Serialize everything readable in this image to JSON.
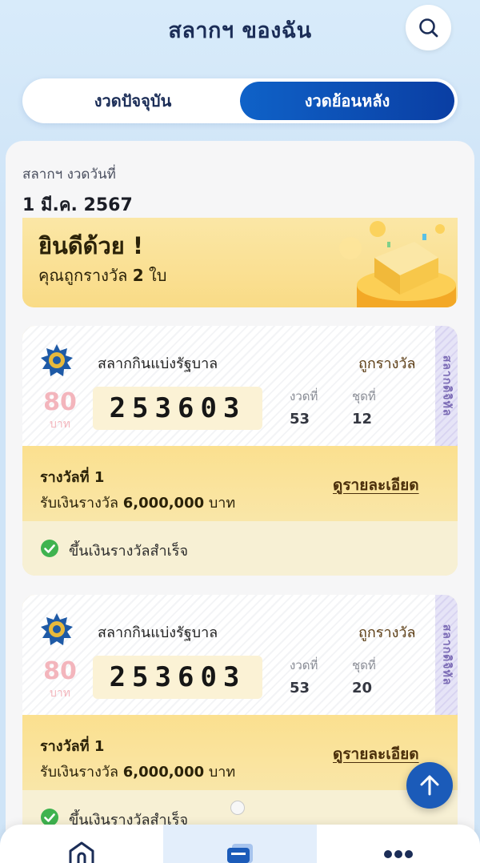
{
  "header": {
    "title": "สลากฯ ของฉัน",
    "search_icon": "search-icon"
  },
  "tabs": {
    "current_label": "งวดปัจจุบัน",
    "past_label": "งวดย้อนหลัง",
    "selected": "past"
  },
  "draw": {
    "caption": "สลากฯ งวดวันที่",
    "date": "1 มี.ค. 2567"
  },
  "banner": {
    "title": "ยินดีด้วย !",
    "sub_prefix": "คุณถูกรางวัล",
    "count": "2",
    "sub_suffix": "ใบ"
  },
  "tickets": [
    {
      "lottery_name": "สลากกินแบ่งรัฐบาล",
      "status": "ถูกรางวัล",
      "price": "80",
      "price_unit": "บาท",
      "number": "253603",
      "draw_label": "งวดที่",
      "draw_no": "53",
      "set_label": "ชุดที่",
      "set_no": "12",
      "side_tag": "สลากดิจิทัล",
      "prize_name": "รางวัลที่ 1",
      "prize_prefix": "รับเงินรางวัล",
      "prize_amount": "6,000,000",
      "prize_unit": "บาท",
      "details_label": "ดูรายละเอียด",
      "claim_status": "ขึ้นเงินรางวัลสำเร็จ"
    },
    {
      "lottery_name": "สลากกินแบ่งรัฐบาล",
      "status": "ถูกรางวัล",
      "price": "80",
      "price_unit": "บาท",
      "number": "253603",
      "draw_label": "งวดที่",
      "draw_no": "53",
      "set_label": "ชุดที่",
      "set_no": "20",
      "side_tag": "สลากดิจิทัล",
      "prize_name": "รางวัลที่ 1",
      "prize_prefix": "รับเงินรางวัล",
      "prize_amount": "6,000,000",
      "prize_unit": "บาท",
      "details_label": "ดูรายละเอียด",
      "claim_status": "ขึ้นเงินรางวัลสำเร็จ"
    }
  ],
  "colors": {
    "primary": "#0f62c8",
    "gold": "#f9db86",
    "success": "#3fb34f"
  },
  "nav": {
    "home_icon": "home-icon",
    "tickets_icon": "tickets-icon",
    "more_icon": "more-icon"
  }
}
